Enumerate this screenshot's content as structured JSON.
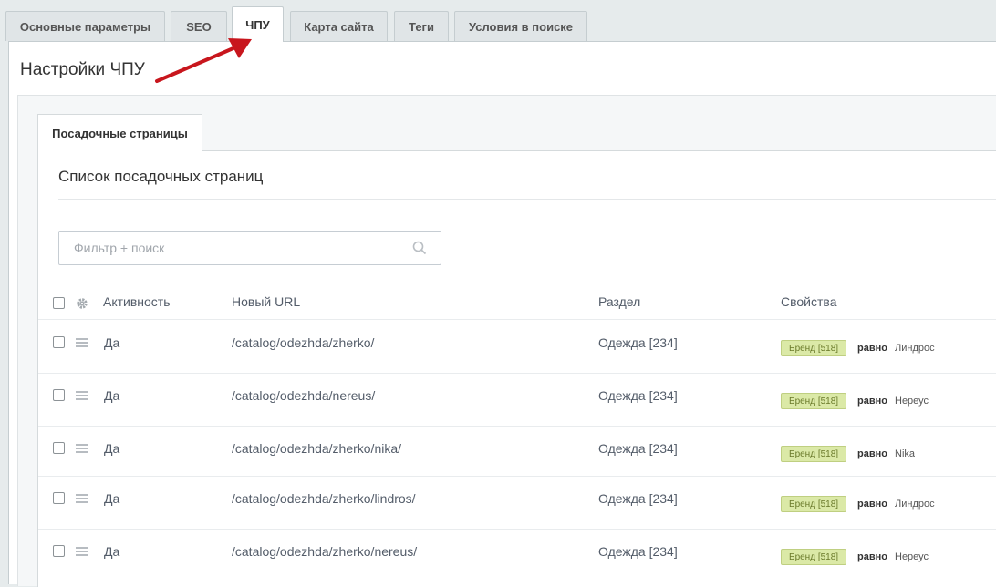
{
  "tabs": [
    {
      "label": "Основные параметры",
      "active": false
    },
    {
      "label": "SEO",
      "active": false
    },
    {
      "label": "ЧПУ",
      "active": true
    },
    {
      "label": "Карта сайта",
      "active": false
    },
    {
      "label": "Теги",
      "active": false
    },
    {
      "label": "Условия в поиске",
      "active": false
    }
  ],
  "panel": {
    "title": "Настройки ЧПУ",
    "subtab": "Посадочные страницы",
    "list_title": "Список посадочных страниц"
  },
  "filter": {
    "placeholder": "Фильтр + поиск"
  },
  "table": {
    "headers": {
      "active": "Активность",
      "url": "Новый URL",
      "section": "Раздел",
      "props": "Свойства"
    },
    "rows": [
      {
        "active": "Да",
        "url": "/catalog/odezhda/zherko/",
        "section": "Одежда [234]",
        "badge": "Бренд [518]",
        "op": "равно",
        "value": "Линдрос"
      },
      {
        "active": "Да",
        "url": "/catalog/odezhda/nereus/",
        "section": "Одежда [234]",
        "badge": "Бренд [518]",
        "op": "равно",
        "value": "Нереус"
      },
      {
        "active": "Да",
        "url": "/catalog/odezhda/zherko/nika/",
        "section": "Одежда [234]",
        "badge": "Бренд [518]",
        "op": "равно",
        "value": "Nika"
      },
      {
        "active": "Да",
        "url": "/catalog/odezhda/zherko/lindros/",
        "section": "Одежда [234]",
        "badge": "Бренд [518]",
        "op": "равно",
        "value": "Линдрос"
      },
      {
        "active": "Да",
        "url": "/catalog/odezhda/zherko/nereus/",
        "section": "Одежда [234]",
        "badge": "Бренд [518]",
        "op": "равно",
        "value": "Нереус"
      }
    ]
  },
  "colors": {
    "badge_bg": "#dbe9a7",
    "arrow": "#c8161d"
  },
  "icons": {
    "filter": "search-icon",
    "settings": "gear-icon",
    "drag": "drag-handle-icon",
    "annotation": "red-arrow-icon"
  }
}
